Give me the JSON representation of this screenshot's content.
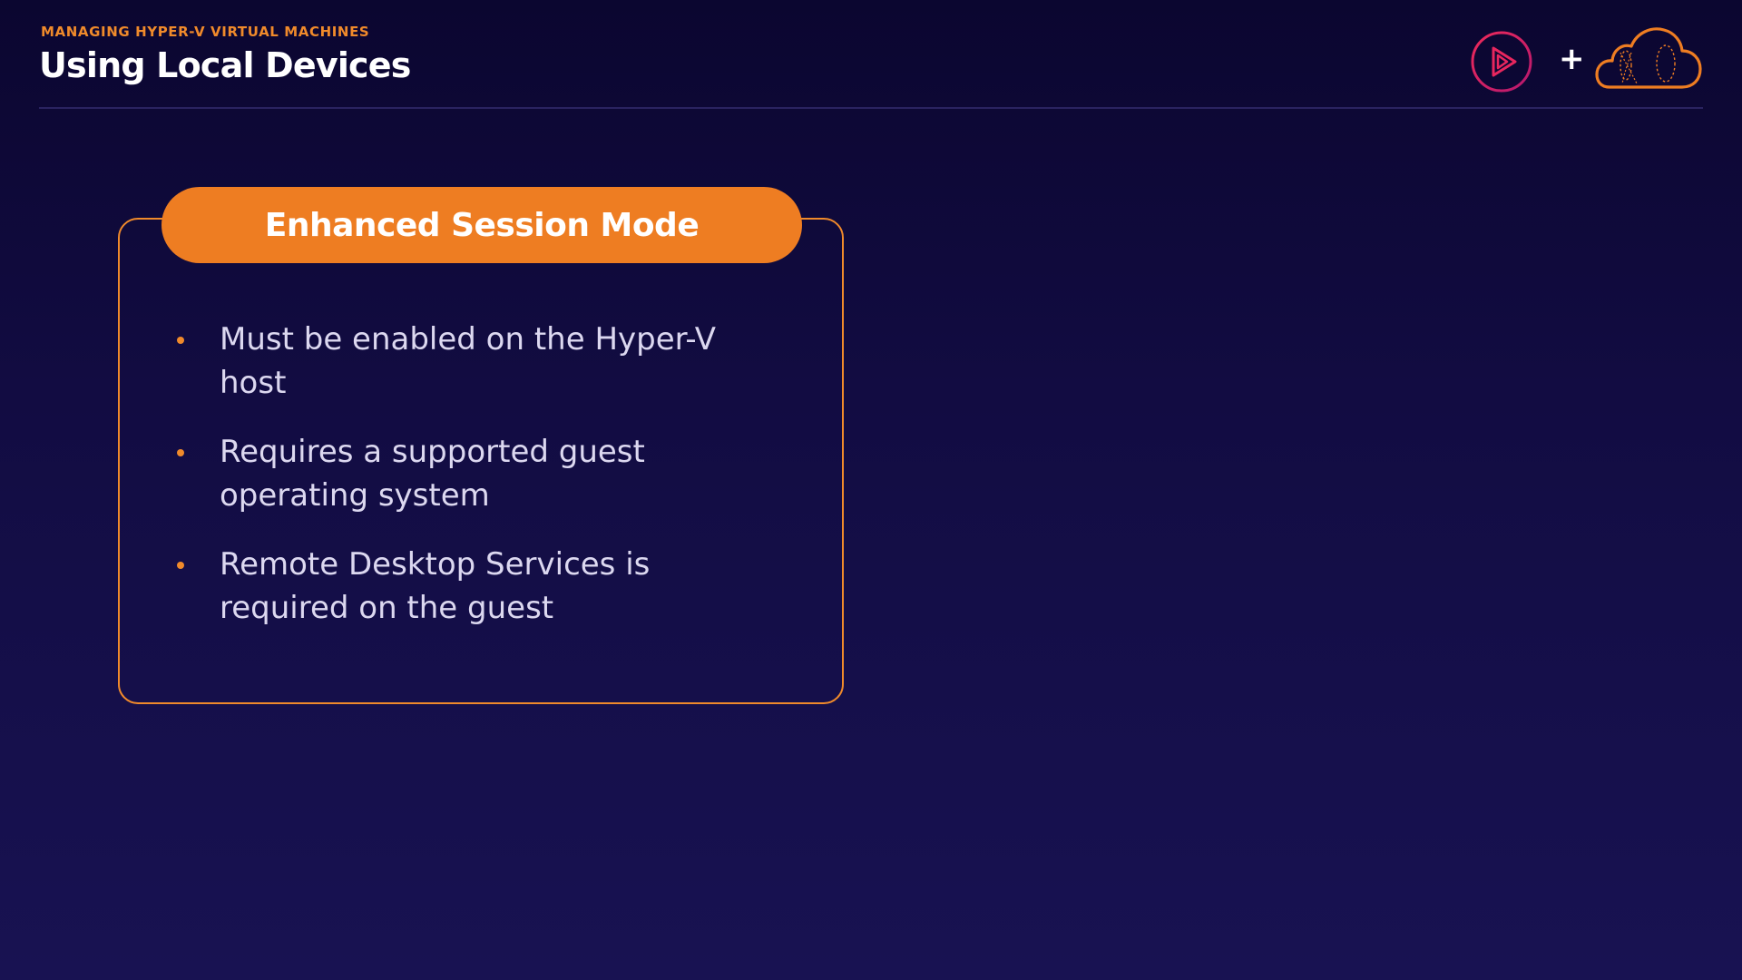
{
  "header": {
    "eyebrow": "MANAGING HYPER-V VIRTUAL MACHINES",
    "title": "Using Local Devices"
  },
  "logos": {
    "left": "play-icon",
    "separator": "+",
    "right": "cloud-icon"
  },
  "card": {
    "heading": "Enhanced Session Mode",
    "bullets": [
      "Must be enabled on the Hyper-V host",
      "Requires a supported guest operating system",
      "Remote Desktop Services is required on the guest"
    ]
  },
  "colors": {
    "accent": "#ee7d22",
    "background_top": "#0b0630",
    "background_bottom": "#181252",
    "play_ring_start": "#e3226b",
    "play_ring_end": "#b6186e"
  }
}
